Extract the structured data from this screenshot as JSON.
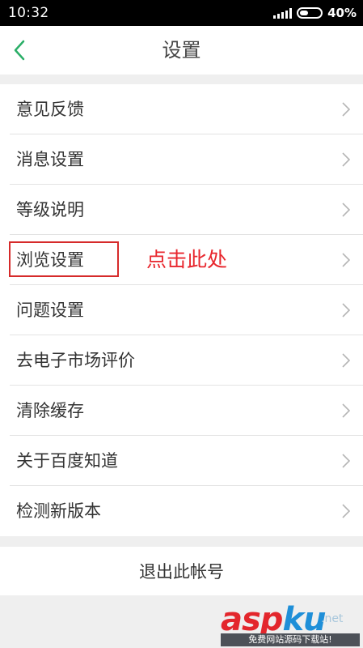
{
  "status_bar": {
    "time": "10:32",
    "battery": "40%",
    "battery_level": 0.4
  },
  "header": {
    "title": "设置",
    "back_icon": "chevron-left-icon"
  },
  "menu": {
    "items": [
      {
        "label": "意见反馈"
      },
      {
        "label": "消息设置"
      },
      {
        "label": "等级说明"
      },
      {
        "label": "浏览设置"
      },
      {
        "label": "问题设置"
      },
      {
        "label": "去电子市场评价"
      },
      {
        "label": "清除缓存"
      },
      {
        "label": "关于百度知道"
      },
      {
        "label": "检测新版本"
      }
    ]
  },
  "annotation": {
    "text": "点击此处",
    "color": "#e8262d"
  },
  "logout": {
    "label": "退出此帐号"
  },
  "watermark": {
    "main_asp": "asp",
    "main_ku": "ku",
    "suffix": ".net",
    "sub": "免费网站源码下载站!"
  },
  "colors": {
    "accent_green": "#2aae67",
    "background": "#efefef",
    "annotation_red": "#d62a2a"
  }
}
